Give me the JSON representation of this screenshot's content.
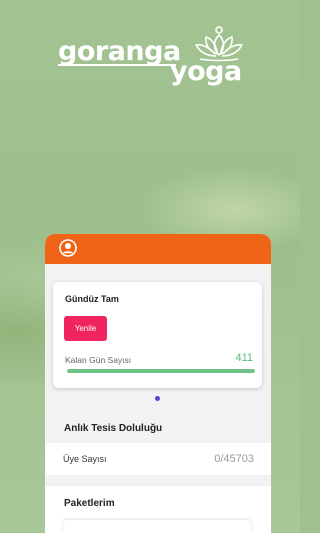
{
  "brand": {
    "name_part1": "goranga",
    "name_part2": "yoga"
  },
  "colors": {
    "header_accent": "#f06418",
    "renew_button": "#f0245f",
    "progress_fill": "#6cc486",
    "page_indicator": "#5b3fd0"
  },
  "membership_card": {
    "title": "Gündüz Tam",
    "renew_label": "Yenile",
    "remaining_days_label": "Kalan Gün Sayısı",
    "remaining_days_value": "411",
    "remaining_days_progress_fraction": 1.0
  },
  "carousel": {
    "pages": 1,
    "active_index": 0
  },
  "occupancy": {
    "title": "Anlık Tesis Doluluğu",
    "member_count_label": "Üye Sayısı",
    "member_count_value": "0/45703"
  },
  "packages": {
    "title": "Paketlerim"
  },
  "icons": {
    "profile": "user-circle-icon",
    "logo_mark": "lotus-icon"
  }
}
